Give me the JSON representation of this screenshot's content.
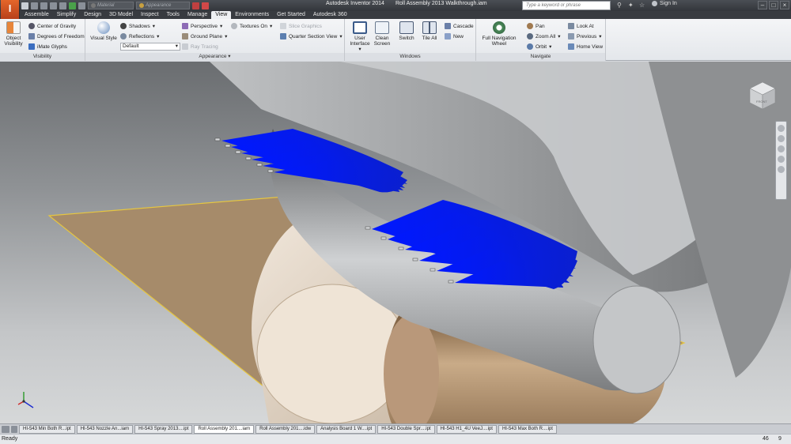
{
  "window": {
    "app_name": "Autodesk Inventor 2014",
    "document_title": "Roll Assembly 2013 Walkthrough.iam",
    "search_placeholder": "Type a keyword or phrase",
    "sign_in": "Sign In"
  },
  "qat": {
    "material": "Material",
    "appearance": "Appearance"
  },
  "tabs": [
    "Assemble",
    "Simplify",
    "Design",
    "3D Model",
    "Inspect",
    "Tools",
    "Manage",
    "View",
    "Environments",
    "Get Started",
    "Autodesk 360"
  ],
  "active_tab": "View",
  "ribbon": {
    "visibility": {
      "title": "Visibility",
      "object_visibility": "Object Visibility",
      "center_of_gravity": "Center of Gravity",
      "degrees_of_freedom": "Degrees of Freedom",
      "imate_glyphs": "iMate Glyphs"
    },
    "appearance": {
      "title": "Appearance",
      "visual_style": "Visual Style",
      "shadows": "Shadows",
      "reflections": "Reflections",
      "style_value": "Default",
      "perspective": "Perspective",
      "ground_plane": "Ground Plane",
      "ray_tracing": "Ray Tracing",
      "textures_on": "Textures On",
      "slice_graphics": "Slice Graphics",
      "quarter_section_view": "Quarter Section View"
    },
    "windows": {
      "title": "Windows",
      "user_interface": "User Interface",
      "clean_screen": "Clean Screen",
      "switch": "Switch",
      "tile_all": "Tile All",
      "cascade": "Cascade",
      "new": "New"
    },
    "navigate": {
      "title": "Navigate",
      "full_navigation_wheel": "Full Navigation Wheel",
      "pan": "Pan",
      "zoom_all": "Zoom All",
      "orbit": "Orbit",
      "look_at": "Look At",
      "previous": "Previous",
      "home_view": "Home View"
    }
  },
  "viewcube": {
    "label": "FRONT"
  },
  "document_tabs": [
    {
      "label": "HI-543 Min Both R...ipt",
      "active": false
    },
    {
      "label": "HI-543 Nozzle An...iam",
      "active": false
    },
    {
      "label": "HI-543 Spray 2013....ipt",
      "active": false
    },
    {
      "label": "Roll Assembly 201....iam",
      "active": true
    },
    {
      "label": "Roll Assembly 201....idw",
      "active": false
    },
    {
      "label": "Analysis Board 1 W....ipt",
      "active": false
    },
    {
      "label": "HI-543 Double Spr....ipt",
      "active": false
    },
    {
      "label": "HI-543 H1_4U VeeJ....ipt",
      "active": false
    },
    {
      "label": "HI-543 Max Both R....ipt",
      "active": false
    }
  ],
  "status": {
    "text": "Ready",
    "count1": "46",
    "count2": "9"
  },
  "colors": {
    "nozzle_blue": "#0b1cff",
    "roller_tan": "#9c7e5e",
    "ground_plane": "#a68b6a",
    "edge_yellow": "#e6c640"
  }
}
